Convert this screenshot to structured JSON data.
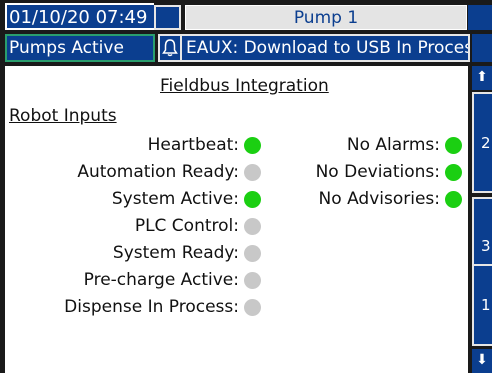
{
  "header": {
    "datetime": "01/10/20 07:49",
    "title": "Pump 1",
    "status": "Pumps Active",
    "advisory": "EAUX: Download to USB In Process"
  },
  "screen": {
    "title": "Fieldbus Integration",
    "section": "Robot Inputs"
  },
  "robot_inputs_left": [
    {
      "label": "Heartbeat:",
      "state": "on"
    },
    {
      "label": "Automation Ready:",
      "state": "off"
    },
    {
      "label": "System Active:",
      "state": "on"
    },
    {
      "label": "PLC Control:",
      "state": "off"
    },
    {
      "label": "System Ready:",
      "state": "off"
    },
    {
      "label": "Pre-charge Active:",
      "state": "off"
    },
    {
      "label": "Dispense In Process:",
      "state": "off"
    }
  ],
  "robot_inputs_right": [
    {
      "label": "No Alarms:",
      "state": "on"
    },
    {
      "label": "No Deviations:",
      "state": "on"
    },
    {
      "label": "No Advisories:",
      "state": "on"
    }
  ],
  "side_panel": {
    "up_arrow": "⬆",
    "down_arrow": "⬇",
    "buttons": [
      "2",
      "3",
      "1"
    ]
  },
  "colors": {
    "header_blue": "#0b3e8f",
    "indicator_on": "#1bcf12",
    "indicator_off": "#c8c8c8",
    "status_border": "#2a9e6e"
  },
  "icons": {
    "advisory": "bell-icon"
  }
}
